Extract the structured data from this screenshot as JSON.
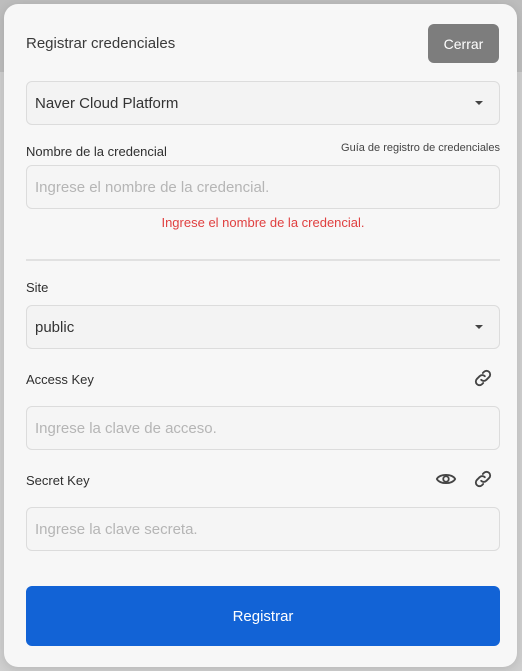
{
  "modal": {
    "title": "Registrar credenciales",
    "close_label": "Cerrar"
  },
  "provider": {
    "selected": "Naver Cloud Platform"
  },
  "credential_name": {
    "label": "Nombre de la credencial",
    "guide_link": "Guía de registro de credenciales",
    "placeholder": "Ingrese el nombre de la credencial.",
    "value": "",
    "error": "Ingrese el nombre de la credencial."
  },
  "site": {
    "label": "Site",
    "selected": "public"
  },
  "access_key": {
    "label": "Access Key",
    "placeholder": "Ingrese la clave de acceso.",
    "value": "",
    "icon": "link-icon"
  },
  "secret_key": {
    "label": "Secret Key",
    "placeholder": "Ingrese la clave secreta.",
    "value": "",
    "icons": [
      "eye-icon",
      "link-icon"
    ]
  },
  "submit_label": "Registrar",
  "colors": {
    "primary": "#1263d6",
    "error": "#e04040",
    "close_button": "#7d7d7d"
  }
}
